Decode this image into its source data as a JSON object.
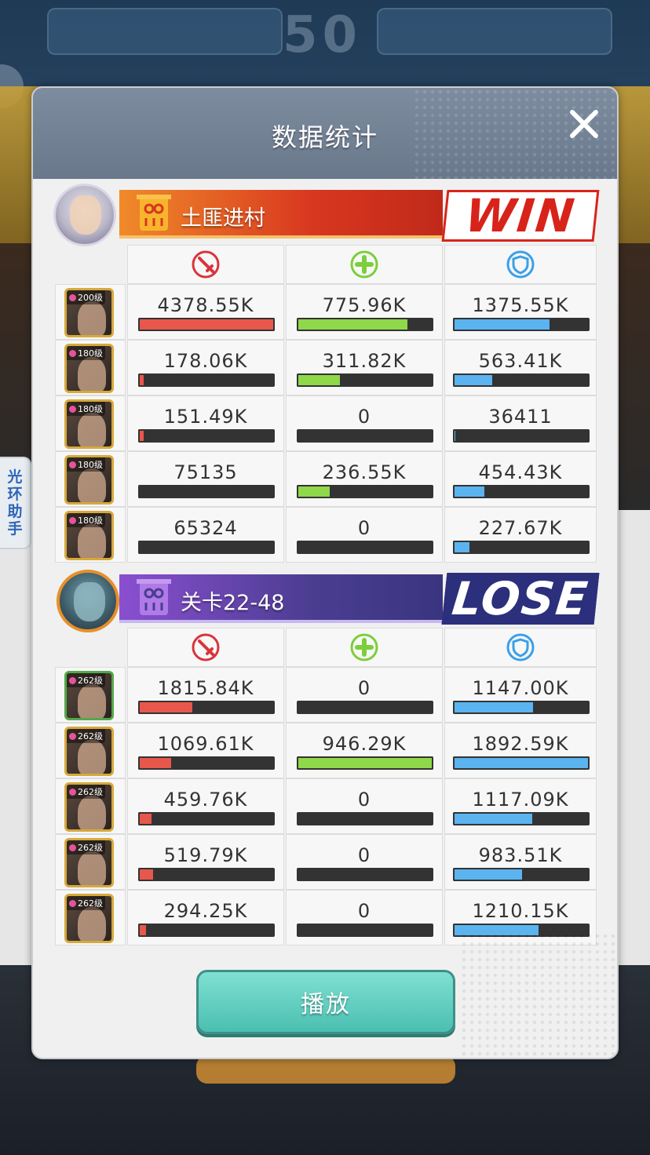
{
  "background": {
    "score_text": "50",
    "side_helper_label": [
      "光",
      "环",
      "助",
      "手"
    ]
  },
  "dialog": {
    "title": "数据统计",
    "play_label": "播放"
  },
  "colors": {
    "damage": "#e8574c",
    "heal": "#8fd84a",
    "tank": "#5bb4ef",
    "win": "#d8231a",
    "lose": "#2b2f7c"
  },
  "icons": {
    "damage": "sword-damage-icon",
    "heal": "plus-heal-icon",
    "tank": "shield-tank-icon"
  },
  "team_win": {
    "name": "土匪进村",
    "result": "WIN",
    "heroes": [
      {
        "level": "200级",
        "damage": "4378.55K",
        "damage_pct": 100,
        "heal": "775.96K",
        "heal_pct": 82,
        "tank": "1375.55K",
        "tank_pct": 72
      },
      {
        "level": "180级",
        "damage": "178.06K",
        "damage_pct": 5,
        "heal": "311.82K",
        "heal_pct": 33,
        "tank": "563.41K",
        "tank_pct": 30
      },
      {
        "level": "180级",
        "damage": "151.49K",
        "damage_pct": 5,
        "heal": "0",
        "heal_pct": 0,
        "tank": "36411",
        "tank_pct": 3
      },
      {
        "level": "180级",
        "damage": "75135",
        "damage_pct": 2,
        "heal": "236.55K",
        "heal_pct": 25,
        "tank": "454.43K",
        "tank_pct": 24
      },
      {
        "level": "180级",
        "damage": "65324",
        "damage_pct": 2,
        "heal": "0",
        "heal_pct": 0,
        "tank": "227.67K",
        "tank_pct": 13
      }
    ]
  },
  "team_lose": {
    "name": "关卡22-48",
    "result": "LOSE",
    "heroes": [
      {
        "level": "262级",
        "damage": "1815.84K",
        "damage_pct": 41,
        "heal": "0",
        "heal_pct": 0,
        "tank": "1147.00K",
        "tank_pct": 60
      },
      {
        "level": "262级",
        "damage": "1069.61K",
        "damage_pct": 25,
        "heal": "946.29K",
        "heal_pct": 100,
        "tank": "1892.59K",
        "tank_pct": 100
      },
      {
        "level": "262级",
        "damage": "459.76K",
        "damage_pct": 11,
        "heal": "0",
        "heal_pct": 0,
        "tank": "1117.09K",
        "tank_pct": 59
      },
      {
        "level": "262级",
        "damage": "519.79K",
        "damage_pct": 12,
        "heal": "0",
        "heal_pct": 0,
        "tank": "983.51K",
        "tank_pct": 52
      },
      {
        "level": "262级",
        "damage": "294.25K",
        "damage_pct": 7,
        "heal": "0",
        "heal_pct": 0,
        "tank": "1210.15K",
        "tank_pct": 64
      }
    ]
  }
}
